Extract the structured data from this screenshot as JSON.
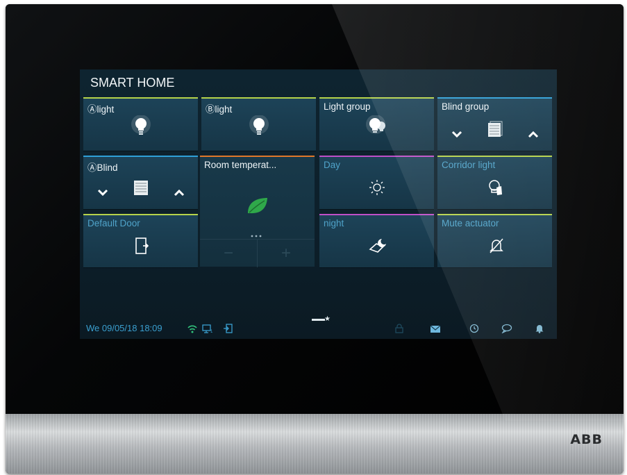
{
  "brand": "ABB",
  "screen": {
    "title": "SMART HOME",
    "tiles": [
      {
        "label": "Ⓐlight",
        "icon": "bulb-icon",
        "accent": "#b6d34a"
      },
      {
        "label": "Ⓑlight",
        "icon": "bulb-icon",
        "accent": "#b6d34a"
      },
      {
        "label": "Light group",
        "icon": "bulb-group-icon",
        "accent": "#b6d34a"
      },
      {
        "label": "Blind group",
        "icon": "blind-icon",
        "accent": "#2fa0d8"
      },
      {
        "label": "ⒶBlind",
        "icon": "blind-icon",
        "accent": "#2fa0d8"
      },
      {
        "label": "Room temperat...",
        "icon": "leaf-icon",
        "accent": "#e0782a"
      },
      {
        "label": "Day",
        "icon": "sun-icon",
        "accent": "#c04fc8"
      },
      {
        "label": "Corridor light",
        "icon": "corridor-light-icon",
        "accent": "#b6d34a"
      },
      {
        "label": "Default Door",
        "icon": "door-icon",
        "accent": "#b6d34a"
      },
      {
        "label": "night",
        "icon": "night-icon",
        "accent": "#c04fc8"
      },
      {
        "label": "Mute actuator",
        "icon": "bell-muted-icon",
        "accent": "#b6d34a"
      }
    ],
    "room_temperature": {
      "minus": "−",
      "plus": "+"
    }
  },
  "status": {
    "datetime": "We 09/05/18  18:09",
    "icons": [
      "wifi-icon",
      "monitor-icon",
      "logout-icon",
      "page-indicator",
      "lock-icon",
      "mail-icon",
      "clock-icon",
      "chat-icon",
      "bell-icon"
    ],
    "page_indicator": "▬▬★"
  },
  "colors": {
    "accent_green": "#b6d34a",
    "accent_blue": "#2fa0d8",
    "accent_magenta": "#c04fc8",
    "accent_orange": "#e0782a",
    "label_blue": "#4fa3c9",
    "leaf_green": "#2fa84a"
  }
}
